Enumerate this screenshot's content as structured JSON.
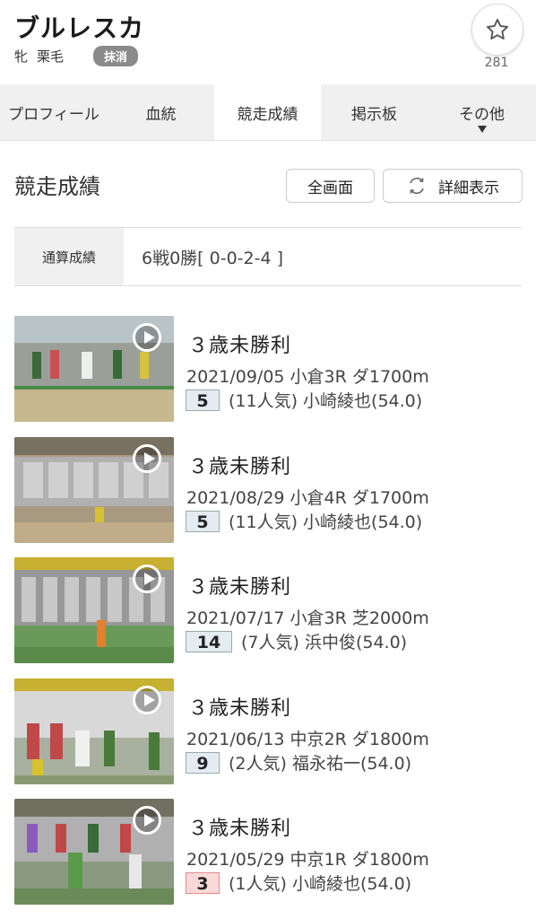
{
  "horse": {
    "name": "ブルレスカ",
    "sex": "牝",
    "color": "栗毛",
    "status_badge": "抹消",
    "favorite_count": "281"
  },
  "tabs": [
    {
      "label": "プロフィール",
      "active": false
    },
    {
      "label": "血統",
      "active": false
    },
    {
      "label": "競走成績",
      "active": true
    },
    {
      "label": "掲示板",
      "active": false
    },
    {
      "label": "その他",
      "active": false
    }
  ],
  "section": {
    "title": "競走成績",
    "fullscreen_label": "全画面",
    "detail_label": "詳細表示"
  },
  "summary": {
    "label": "通算成績",
    "value": "6戦0勝[ 0-0-2-4 ]"
  },
  "races": [
    {
      "name": "３歳未勝利",
      "info": "2021/09/05 小倉3R ダ1700m",
      "rank": "5",
      "result": "(11人気) 小崎綾也(54.0)"
    },
    {
      "name": "３歳未勝利",
      "info": "2021/08/29 小倉4R ダ1700m",
      "rank": "5",
      "result": "(11人気) 小崎綾也(54.0)"
    },
    {
      "name": "３歳未勝利",
      "info": "2021/07/17 小倉3R 芝2000m",
      "rank": "14",
      "result": "(7人気) 浜中俊(54.0)"
    },
    {
      "name": "３歳未勝利",
      "info": "2021/06/13 中京2R ダ1800m",
      "rank": "9",
      "result": "(2人気) 福永祐一(54.0)"
    },
    {
      "name": "３歳未勝利",
      "info": "2021/05/29 中京1R ダ1800m",
      "rank": "3",
      "result": "(1人気) 小崎綾也(54.0)"
    }
  ]
}
